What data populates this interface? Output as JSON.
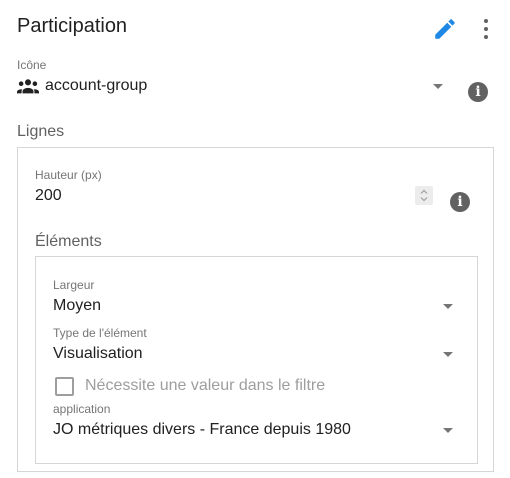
{
  "header": {
    "title": "Participation"
  },
  "icon_field": {
    "label": "Icône",
    "value": "account-group"
  },
  "lines": {
    "label": "Lignes",
    "height": {
      "label": "Hauteur (px)",
      "value": "200"
    },
    "elements": {
      "label": "Éléments",
      "width": {
        "label": "Largeur",
        "value": "Moyen"
      },
      "element_type": {
        "label": "Type de l'élément",
        "value": "Visualisation"
      },
      "require_filter": {
        "label": "Nécessite une valeur dans le filtre",
        "checked": false
      },
      "application": {
        "label": "application",
        "value": "JO métriques divers - France depuis 1980"
      }
    }
  },
  "colors": {
    "accent": "#1e88e5",
    "icon_grey": "#616161",
    "border": "#d6d6d6"
  }
}
